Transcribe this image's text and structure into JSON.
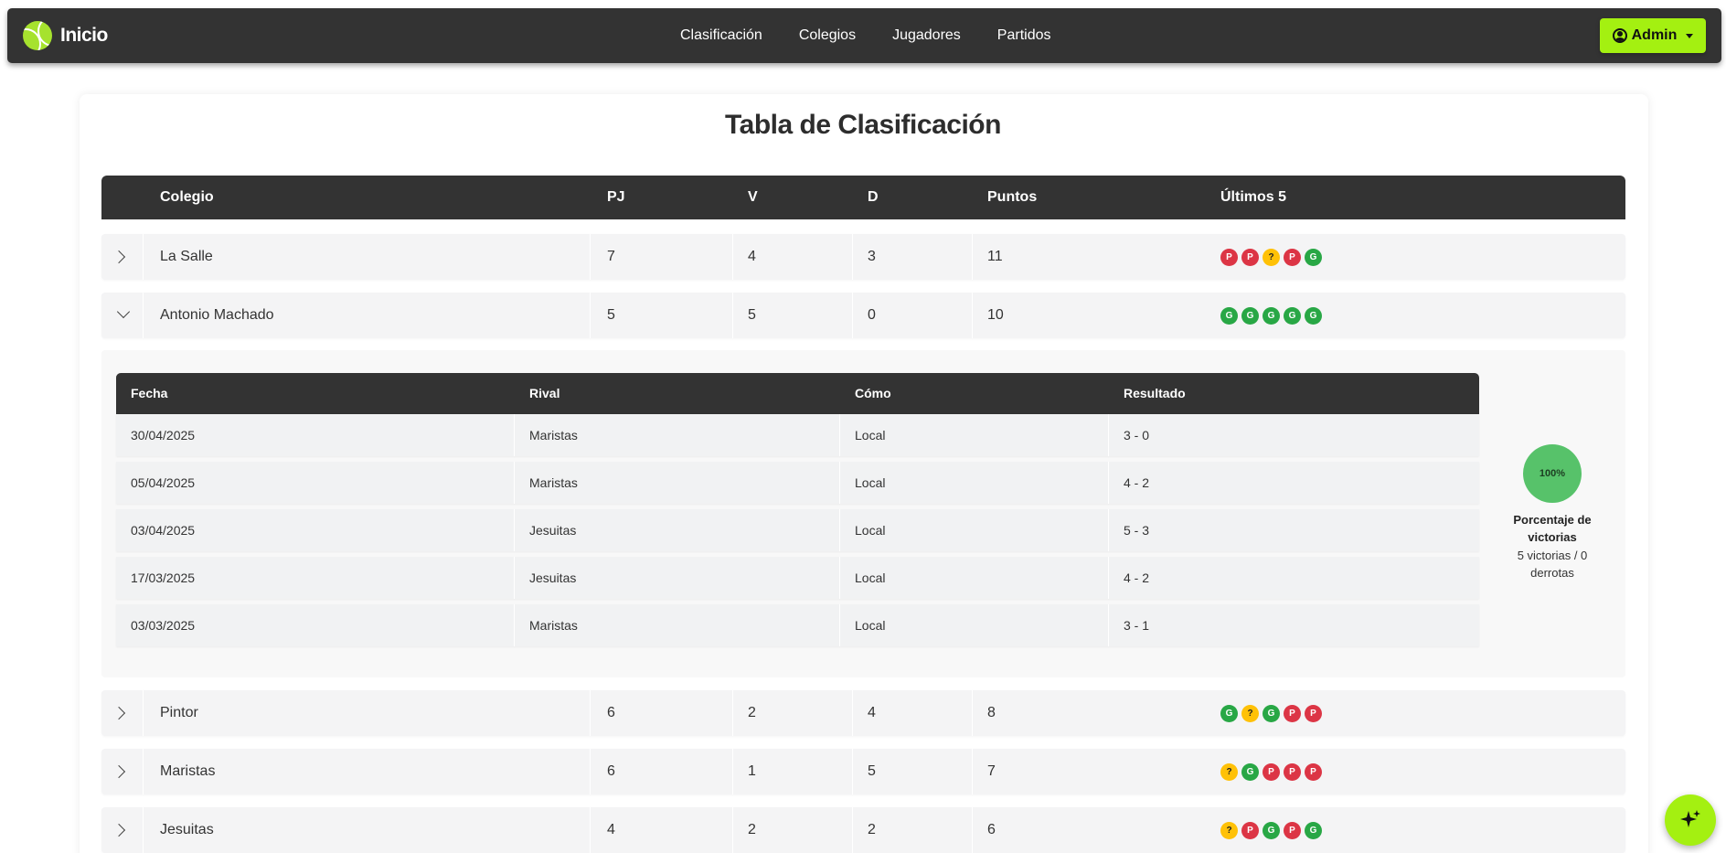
{
  "navbar": {
    "brand": "Inicio",
    "links": [
      "Clasificación",
      "Colegios",
      "Jugadores",
      "Partidos"
    ],
    "admin_label": "Admin"
  },
  "page": {
    "title": "Tabla de Clasificación"
  },
  "standings": {
    "headers": {
      "colegio": "Colegio",
      "pj": "PJ",
      "v": "V",
      "d": "D",
      "puntos": "Puntos",
      "ultimos": "Últimos 5"
    },
    "rows": [
      {
        "colegio": "La Salle",
        "pj": "7",
        "v": "4",
        "d": "3",
        "puntos": "11",
        "ultimos": [
          "P",
          "P",
          "?",
          "P",
          "G"
        ],
        "expanded": false
      },
      {
        "colegio": "Antonio Machado",
        "pj": "5",
        "v": "5",
        "d": "0",
        "puntos": "10",
        "ultimos": [
          "G",
          "G",
          "G",
          "G",
          "G"
        ],
        "expanded": true
      },
      {
        "colegio": "Pintor",
        "pj": "6",
        "v": "2",
        "d": "4",
        "puntos": "8",
        "ultimos": [
          "G",
          "?",
          "G",
          "P",
          "P"
        ],
        "expanded": false
      },
      {
        "colegio": "Maristas",
        "pj": "6",
        "v": "1",
        "d": "5",
        "puntos": "7",
        "ultimos": [
          "?",
          "G",
          "P",
          "P",
          "P"
        ],
        "expanded": false
      },
      {
        "colegio": "Jesuitas",
        "pj": "4",
        "v": "2",
        "d": "2",
        "puntos": "6",
        "ultimos": [
          "?",
          "P",
          "G",
          "P",
          "G"
        ],
        "expanded": false
      }
    ]
  },
  "detail": {
    "headers": {
      "fecha": "Fecha",
      "rival": "Rival",
      "como": "Cómo",
      "resultado": "Resultado"
    },
    "rows": [
      {
        "fecha": "30/04/2025",
        "rival": "Maristas",
        "como": "Local",
        "resultado": "3 - 0"
      },
      {
        "fecha": "05/04/2025",
        "rival": "Maristas",
        "como": "Local",
        "resultado": "4 - 2"
      },
      {
        "fecha": "03/04/2025",
        "rival": "Jesuitas",
        "como": "Local",
        "resultado": "5 - 3"
      },
      {
        "fecha": "17/03/2025",
        "rival": "Jesuitas",
        "como": "Local",
        "resultado": "4 - 2"
      },
      {
        "fecha": "03/03/2025",
        "rival": "Maristas",
        "como": "Local",
        "resultado": "3 - 1"
      }
    ],
    "win_pct": "100%",
    "win_label": "Porcentaje de victorias",
    "win_stats": "5 victorias / 0 derrotas"
  },
  "colors": {
    "accent": "#a4f011",
    "dark": "#333333",
    "win": "#28a745",
    "loss": "#dc3545",
    "pending": "#ffc107"
  },
  "icons": {
    "brand": "tennis-ball-icon",
    "admin": "user-circle-icon",
    "fab": "sparkle-icon"
  }
}
